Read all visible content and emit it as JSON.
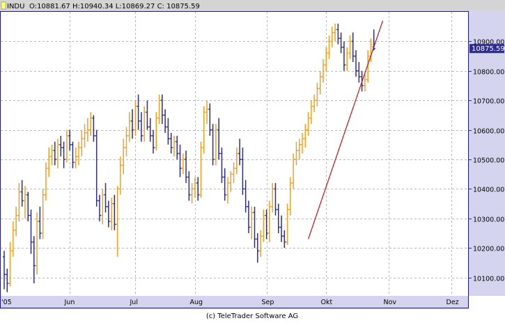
{
  "header": {
    "symbol": "INDU",
    "ohlc": "O:10881.67 H:10940.34 L:10869.27 C: 10875.59"
  },
  "footer": {
    "copyright": "(c) TeleTrader Software AG"
  },
  "last_price_label": "10875.59",
  "colors": {
    "up": "#f0a020",
    "down": "#2c2c8c",
    "trendline": "#c01020",
    "axis_bg": "#d4d4ee",
    "header_bg": "#d4d4d4",
    "plot_border": "#1a1a80",
    "grid": "#b8b8b8",
    "price_tag_bg": "#2c2c8c",
    "price_tag_text": "#ffffff"
  },
  "chart_data": {
    "type": "ohlc",
    "title": "",
    "xlabel": "",
    "ylabel": "",
    "grid": true,
    "y_axis_position": "right",
    "ylim": [
      10040,
      11000
    ],
    "yticks": [
      10100,
      10200,
      10300,
      10400,
      10500,
      10600,
      10700,
      10800,
      10900
    ],
    "ytick_labels": [
      "10100.00",
      "10200.00",
      "10300.00",
      "10400.00",
      "10500.00",
      "10600.00",
      "10700.00",
      "10800.00",
      "10900.00"
    ],
    "xtick_labels": [
      {
        "label": "'05",
        "bar_index": 0
      },
      {
        "label": "Jun",
        "bar_index": 22
      },
      {
        "label": "Jul",
        "bar_index": 44
      },
      {
        "label": "Aug",
        "bar_index": 64
      },
      {
        "label": "Sep",
        "bar_index": 88
      },
      {
        "label": "Okt",
        "bar_index": 108
      },
      {
        "label": "Nov",
        "bar_index": 129
      },
      {
        "label": "Dez",
        "bar_index": 150
      }
    ],
    "bars": [
      [
        10170,
        10190,
        10060,
        10110
      ],
      [
        10110,
        10130,
        10050,
        10080
      ],
      [
        10080,
        10220,
        10070,
        10190
      ],
      [
        10190,
        10290,
        10170,
        10260
      ],
      [
        10260,
        10340,
        10240,
        10310
      ],
      [
        10310,
        10420,
        10290,
        10390
      ],
      [
        10390,
        10430,
        10340,
        10360
      ],
      [
        10360,
        10410,
        10300,
        10380
      ],
      [
        10380,
        10390,
        10290,
        10310
      ],
      [
        10310,
        10330,
        10180,
        10220
      ],
      [
        10220,
        10240,
        10080,
        10140
      ],
      [
        10140,
        10320,
        10110,
        10290
      ],
      [
        10290,
        10340,
        10230,
        10250
      ],
      [
        10250,
        10400,
        10230,
        10380
      ],
      [
        10380,
        10490,
        10360,
        10470
      ],
      [
        10470,
        10540,
        10440,
        10510
      ],
      [
        10510,
        10550,
        10480,
        10530
      ],
      [
        10530,
        10560,
        10480,
        10500
      ],
      [
        10500,
        10570,
        10470,
        10550
      ],
      [
        10550,
        10580,
        10510,
        10540
      ],
      [
        10540,
        10560,
        10470,
        10500
      ],
      [
        10500,
        10600,
        10490,
        10580
      ],
      [
        10580,
        10600,
        10530,
        10550
      ],
      [
        10550,
        10560,
        10470,
        10490
      ],
      [
        10490,
        10540,
        10470,
        10510
      ],
      [
        10510,
        10560,
        10480,
        10540
      ],
      [
        10540,
        10600,
        10510,
        10570
      ],
      [
        10570,
        10620,
        10540,
        10590
      ],
      [
        10590,
        10640,
        10560,
        10600
      ],
      [
        10600,
        10660,
        10580,
        10640
      ],
      [
        10640,
        10650,
        10560,
        10580
      ],
      [
        10580,
        10600,
        10340,
        10360
      ],
      [
        10360,
        10380,
        10290,
        10310
      ],
      [
        10310,
        10400,
        10280,
        10380
      ],
      [
        10380,
        10420,
        10320,
        10340
      ],
      [
        10340,
        10360,
        10270,
        10290
      ],
      [
        10290,
        10370,
        10260,
        10350
      ],
      [
        10350,
        10380,
        10260,
        10280
      ],
      [
        10280,
        10410,
        10170,
        10400
      ],
      [
        10400,
        10510,
        10380,
        10480
      ],
      [
        10480,
        10570,
        10450,
        10540
      ],
      [
        10540,
        10610,
        10510,
        10580
      ],
      [
        10580,
        10660,
        10560,
        10630
      ],
      [
        10630,
        10670,
        10570,
        10600
      ],
      [
        10600,
        10700,
        10580,
        10680
      ],
      [
        10680,
        10720,
        10600,
        10630
      ],
      [
        10630,
        10660,
        10560,
        10580
      ],
      [
        10580,
        10680,
        10560,
        10660
      ],
      [
        10660,
        10700,
        10600,
        10610
      ],
      [
        10610,
        10640,
        10560,
        10580
      ],
      [
        10580,
        10600,
        10520,
        10540
      ],
      [
        10540,
        10660,
        10530,
        10640
      ],
      [
        10640,
        10720,
        10620,
        10700
      ],
      [
        10700,
        10720,
        10620,
        10650
      ],
      [
        10650,
        10670,
        10590,
        10610
      ],
      [
        10610,
        10640,
        10550,
        10570
      ],
      [
        10570,
        10590,
        10520,
        10540
      ],
      [
        10540,
        10580,
        10510,
        10560
      ],
      [
        10560,
        10580,
        10500,
        10520
      ],
      [
        10520,
        10550,
        10440,
        10470
      ],
      [
        10470,
        10520,
        10450,
        10500
      ],
      [
        10500,
        10530,
        10420,
        10440
      ],
      [
        10440,
        10460,
        10360,
        10380
      ],
      [
        10380,
        10420,
        10350,
        10400
      ],
      [
        10400,
        10440,
        10370,
        10420
      ],
      [
        10420,
        10440,
        10360,
        10380
      ],
      [
        10380,
        10560,
        10370,
        10540
      ],
      [
        10540,
        10680,
        10520,
        10660
      ],
      [
        10660,
        10700,
        10620,
        10670
      ],
      [
        10670,
        10690,
        10580,
        10600
      ],
      [
        10600,
        10620,
        10480,
        10500
      ],
      [
        10500,
        10620,
        10480,
        10600
      ],
      [
        10600,
        10640,
        10500,
        10520
      ],
      [
        10520,
        10540,
        10420,
        10440
      ],
      [
        10440,
        10470,
        10360,
        10380
      ],
      [
        10380,
        10440,
        10350,
        10420
      ],
      [
        10420,
        10460,
        10390,
        10450
      ],
      [
        10450,
        10490,
        10420,
        10470
      ],
      [
        10470,
        10540,
        10450,
        10520
      ],
      [
        10520,
        10570,
        10480,
        10500
      ],
      [
        10500,
        10540,
        10380,
        10400
      ],
      [
        10400,
        10430,
        10320,
        10340
      ],
      [
        10340,
        10360,
        10250,
        10270
      ],
      [
        10270,
        10340,
        10230,
        10320
      ],
      [
        10320,
        10340,
        10200,
        10230
      ],
      [
        10230,
        10250,
        10150,
        10190
      ],
      [
        10190,
        10260,
        10170,
        10240
      ],
      [
        10240,
        10330,
        10220,
        10310
      ],
      [
        10310,
        10330,
        10230,
        10250
      ],
      [
        10250,
        10360,
        10220,
        10340
      ],
      [
        10340,
        10420,
        10320,
        10400
      ],
      [
        10400,
        10420,
        10310,
        10330
      ],
      [
        10330,
        10350,
        10250,
        10270
      ],
      [
        10270,
        10310,
        10220,
        10240
      ],
      [
        10240,
        10260,
        10200,
        10220
      ],
      [
        10220,
        10350,
        10210,
        10330
      ],
      [
        10330,
        10440,
        10310,
        10420
      ],
      [
        10420,
        10520,
        10400,
        10500
      ],
      [
        10500,
        10560,
        10480,
        10530
      ],
      [
        10530,
        10570,
        10500,
        10550
      ],
      [
        10550,
        10590,
        10520,
        10570
      ],
      [
        10570,
        10620,
        10540,
        10600
      ],
      [
        10600,
        10660,
        10580,
        10640
      ],
      [
        10640,
        10700,
        10620,
        10680
      ],
      [
        10680,
        10720,
        10660,
        10700
      ],
      [
        10700,
        10760,
        10680,
        10740
      ],
      [
        10740,
        10800,
        10720,
        10780
      ],
      [
        10780,
        10840,
        10760,
        10820
      ],
      [
        10820,
        10880,
        10800,
        10860
      ],
      [
        10860,
        10920,
        10840,
        10900
      ],
      [
        10900,
        10950,
        10880,
        10930
      ],
      [
        10930,
        10960,
        10900,
        10940
      ],
      [
        10940,
        10960,
        10890,
        10910
      ],
      [
        10910,
        10930,
        10860,
        10880
      ],
      [
        10880,
        10900,
        10800,
        10820
      ],
      [
        10820,
        10880,
        10800,
        10860
      ],
      [
        10860,
        10920,
        10840,
        10900
      ],
      [
        10900,
        10930,
        10830,
        10850
      ],
      [
        10850,
        10870,
        10780,
        10800
      ],
      [
        10800,
        10830,
        10760,
        10780
      ],
      [
        10780,
        10800,
        10730,
        10750
      ],
      [
        10750,
        10790,
        10730,
        10770
      ],
      [
        10770,
        10870,
        10760,
        10850
      ],
      [
        10850,
        10910,
        10830,
        10890
      ],
      [
        10881.67,
        10940.34,
        10869.27,
        10875.59
      ]
    ],
    "trendline": {
      "from": [
        102,
        10230
      ],
      "to": [
        127,
        10970
      ]
    },
    "last_value": 10875.59
  }
}
